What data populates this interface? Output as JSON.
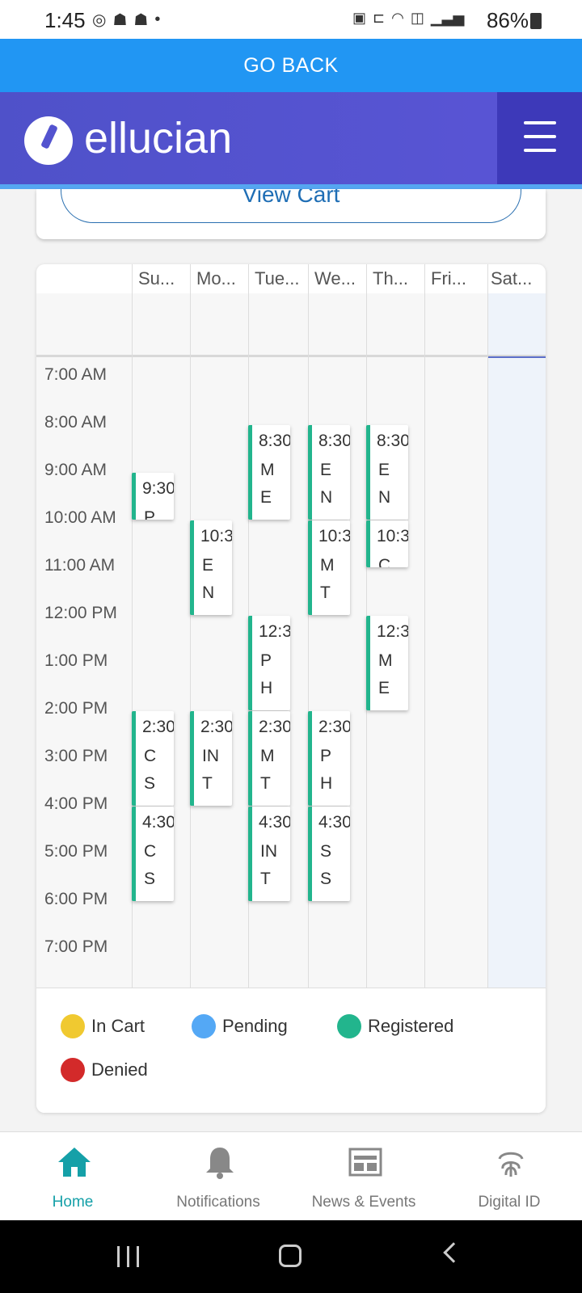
{
  "status_bar": {
    "time": "1:45",
    "battery": "86%",
    "left_icons": [
      "whatsapp-icon",
      "snapchat-icon",
      "snapchat-icon",
      "dot-icon"
    ],
    "right_icons": [
      "battery-saver-icon",
      "sleep-icon",
      "wifi-icon",
      "volte-icon",
      "signal-icon",
      "battery-icon"
    ]
  },
  "go_back_label": "GO BACK",
  "header": {
    "brand": "ellucian",
    "accent_color": "#5353cf",
    "menu_icon": "hamburger-menu-icon"
  },
  "cart": {
    "view_cart_label": "View Cart"
  },
  "calendar": {
    "days": [
      "Su...",
      "Mo...",
      "Tue...",
      "We...",
      "Th...",
      "Fri...",
      "Sat..."
    ],
    "times": [
      "7:00 AM",
      "8:00 AM",
      "9:00 AM",
      "10:00 AM",
      "11:00 AM",
      "12:00 PM",
      "1:00 PM",
      "2:00 PM",
      "3:00 PM",
      "4:00 PM",
      "5:00 PM",
      "6:00 PM",
      "7:00 PM"
    ],
    "events": [
      {
        "day": 0,
        "start_hour": 9.5,
        "end_hour": 10.5,
        "time": "9:30",
        "l1": "P",
        "l2": ""
      },
      {
        "day": 0,
        "start_hour": 14.5,
        "end_hour": 16.5,
        "time": "2:30",
        "l1": "C",
        "l2": "S"
      },
      {
        "day": 0,
        "start_hour": 16.5,
        "end_hour": 18.5,
        "time": "4:30",
        "l1": "C",
        "l2": "S"
      },
      {
        "day": 1,
        "start_hour": 10.5,
        "end_hour": 12.5,
        "time": "10:3",
        "l1": "E",
        "l2": "N"
      },
      {
        "day": 1,
        "start_hour": 14.5,
        "end_hour": 16.5,
        "time": "2:30",
        "l1": "IN",
        "l2": "T"
      },
      {
        "day": 2,
        "start_hour": 8.5,
        "end_hour": 10.5,
        "time": "8:30",
        "l1": "M",
        "l2": "E"
      },
      {
        "day": 2,
        "start_hour": 12.5,
        "end_hour": 14.5,
        "time": "12:3",
        "l1": "P",
        "l2": "H"
      },
      {
        "day": 2,
        "start_hour": 14.5,
        "end_hour": 16.5,
        "time": "2:30",
        "l1": "M",
        "l2": "T"
      },
      {
        "day": 2,
        "start_hour": 16.5,
        "end_hour": 18.5,
        "time": "4:30",
        "l1": "IN",
        "l2": "T"
      },
      {
        "day": 3,
        "start_hour": 8.5,
        "end_hour": 10.5,
        "time": "8:30",
        "l1": "E",
        "l2": "N"
      },
      {
        "day": 3,
        "start_hour": 10.5,
        "end_hour": 12.5,
        "time": "10:3",
        "l1": "M",
        "l2": "T"
      },
      {
        "day": 3,
        "start_hour": 14.5,
        "end_hour": 16.5,
        "time": "2:30",
        "l1": "P",
        "l2": "H"
      },
      {
        "day": 3,
        "start_hour": 16.5,
        "end_hour": 18.5,
        "time": "4:30",
        "l1": "S",
        "l2": "S"
      },
      {
        "day": 4,
        "start_hour": 8.5,
        "end_hour": 10.5,
        "time": "8:30",
        "l1": "E",
        "l2": "N"
      },
      {
        "day": 4,
        "start_hour": 10.5,
        "end_hour": 11.5,
        "time": "10:3",
        "l1": "C",
        "l2": ""
      },
      {
        "day": 4,
        "start_hour": 12.5,
        "end_hour": 14.5,
        "time": "12:3",
        "l1": "M",
        "l2": "E"
      }
    ],
    "registered_color": "#22b58d"
  },
  "legend": [
    {
      "label": "In Cart",
      "color": "#f0c930"
    },
    {
      "label": "Pending",
      "color": "#54a8f5"
    },
    {
      "label": "Registered",
      "color": "#22b58d"
    },
    {
      "label": "Denied",
      "color": "#d32a2a"
    }
  ],
  "bottom_nav": [
    {
      "label": "Home",
      "icon": "home-icon",
      "active": true
    },
    {
      "label": "Notifications",
      "icon": "bell-icon",
      "active": false
    },
    {
      "label": "News & Events",
      "icon": "news-icon",
      "active": false
    },
    {
      "label": "Digital ID",
      "icon": "fingerprint-icon",
      "active": false
    }
  ]
}
